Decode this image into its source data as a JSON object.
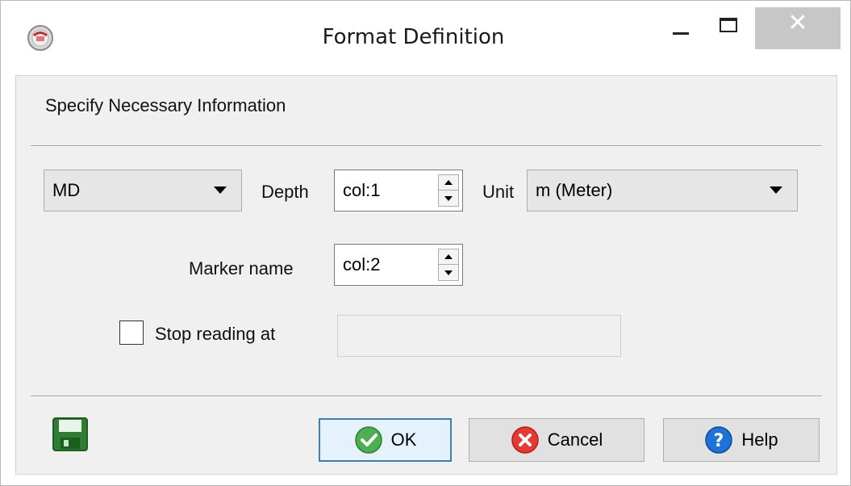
{
  "window": {
    "title": "Format Definition",
    "close_glyph": "✕"
  },
  "panel": {
    "heading": "Specify Necessary Information"
  },
  "depth_row": {
    "type_value": "MD",
    "depth_label": "Depth",
    "depth_value": "col:1",
    "unit_label": "Unit",
    "unit_value": "m (Meter)"
  },
  "marker_row": {
    "label": "Marker name",
    "value": "col:2"
  },
  "stop_row": {
    "label": "Stop reading at",
    "checked": false,
    "value": ""
  },
  "buttons": {
    "ok": "OK",
    "cancel": "Cancel",
    "help": "Help"
  },
  "icons": {
    "app": "app-logo-icon",
    "save": "save-disk-icon",
    "ok": "check-circle-icon",
    "cancel": "x-circle-icon",
    "help": "question-circle-icon"
  },
  "colors": {
    "ok_green": "#4caf50",
    "cancel_red": "#e53935",
    "help_blue": "#1e73d8",
    "save_green": "#2e7d32",
    "default_button_border": "#3c7fb1"
  }
}
